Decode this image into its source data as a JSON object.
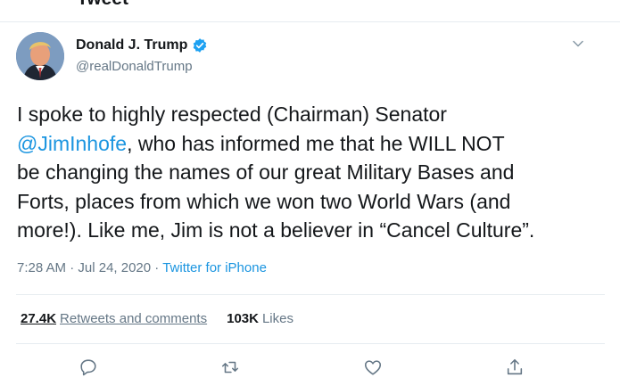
{
  "header": {
    "title": "Tweet"
  },
  "user": {
    "name": "Donald J. Trump",
    "handle": "@realDonaldTrump",
    "verified": true
  },
  "tweet": {
    "lines": [
      {
        "before": "I spoke to highly respected (Chairman) Senator",
        "mention": "",
        "after": ""
      },
      {
        "before": "",
        "mention": "@JimInhofe",
        "after": ", who has informed me that he WILL NOT"
      },
      {
        "before": "be changing the names of our great Military Bases and",
        "mention": "",
        "after": ""
      },
      {
        "before": "Forts, places from which we won two World Wars (and",
        "mention": "",
        "after": ""
      },
      {
        "before": "more!). Like me, Jim is not a believer in “Cancel Culture”.",
        "mention": "",
        "after": ""
      }
    ]
  },
  "meta": {
    "time": "7:28 AM",
    "sep": " · ",
    "date": "Jul 24, 2020",
    "source": "Twitter for iPhone"
  },
  "stats": {
    "retweets_count": "27.4K",
    "retweets_label": "Retweets and comments",
    "likes_count": "103K",
    "likes_label": "Likes"
  },
  "colors": {
    "accent": "#1b95e0",
    "verified": "#1da1f2",
    "secondary_text": "#657786",
    "icon": "#657786"
  },
  "icons": [
    "caret-down-icon",
    "verified-badge-icon",
    "reply-icon",
    "retweet-icon",
    "like-icon",
    "share-icon"
  ]
}
